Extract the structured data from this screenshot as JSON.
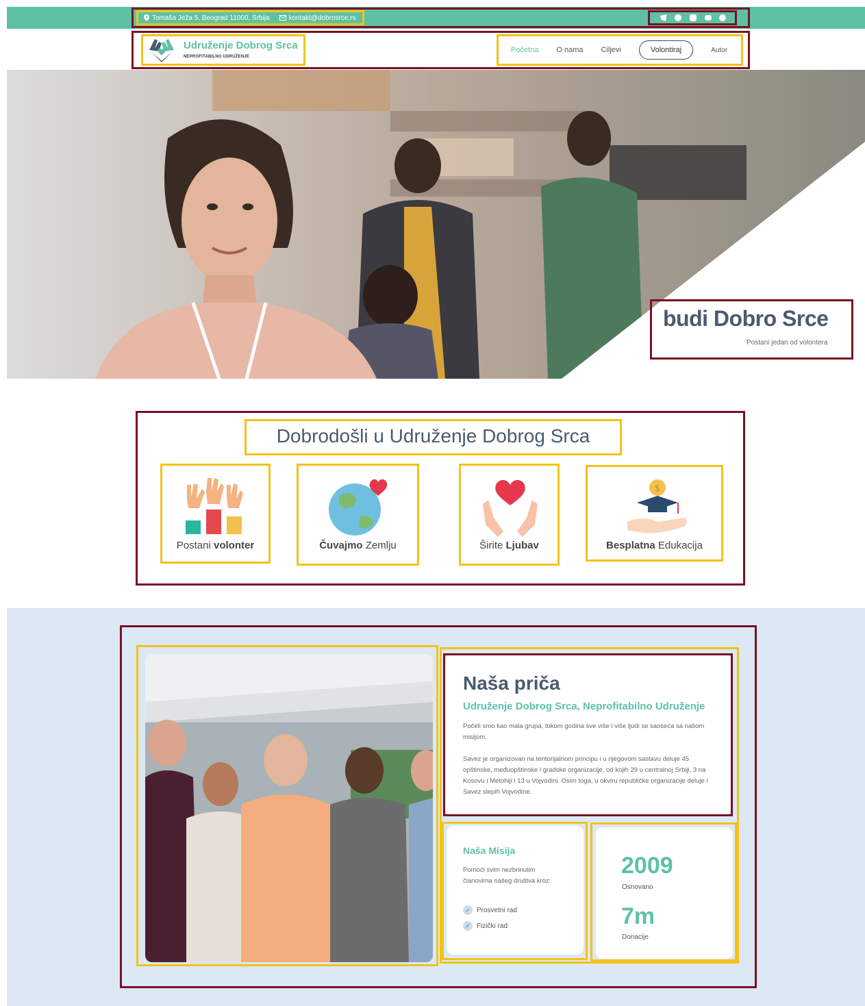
{
  "topbar": {
    "address": "Tomaša Ježa 5, Beograd 11000, Srbija",
    "email": "kontakt@dobrosrce.rs",
    "socials": [
      "twitter-icon",
      "facebook-icon",
      "instagram-icon",
      "youtube-icon",
      "whatsapp-icon"
    ]
  },
  "brand": {
    "name": "Udruženje Dobrog Srca",
    "tagline": "NEPROFITABILNO UDRUŽENJE"
  },
  "nav": {
    "items": [
      "Početna",
      "O nama",
      "Ciljevi"
    ],
    "cta": "Volontiraj",
    "author": "Autor"
  },
  "hero": {
    "title": "budi Dobro Srce",
    "subtitle": "Postani jedan od volontera"
  },
  "welcome": {
    "title": "Dobrodošli u Udruženje Dobrog Srca",
    "features": [
      {
        "pre": "Postani ",
        "bold": "volonter",
        "post": ""
      },
      {
        "pre": "",
        "bold": "Čuvajmo",
        "post": " Zemlju"
      },
      {
        "pre": "Širite ",
        "bold": "Ljubav",
        "post": ""
      },
      {
        "pre": "",
        "bold": "Besplatna",
        "post": " Edukacija"
      }
    ]
  },
  "story": {
    "title": "Naša priča",
    "subtitle": "Udruženje Dobrog Srca, Neprofitabilno Udruženje",
    "p1": "Počeli smo kao mala grupa, tokom godina sve više i više ljudi se saoseća sa našom misijom.",
    "p2": "Savez je organizovan na teritorijalnom principu i u njegovom sastavu deluje 45 opštinske, međuopštinske i gradske organizacije, od kojih 29 u centralnoj Srbiji, 3 na Kosovu i Metohiji i 13 u Vojvodini. Osim toga, u okviru republičke organizacije deluje i Savez slepih Vojvodine.",
    "mission_title": "Naša Misija",
    "mission_text": "Pomoći svim nezbrinutim članovima našeg društva kroz:",
    "mission_items": [
      "Prosvetni rad",
      "Fizički rad"
    ],
    "stat1_value": "2009",
    "stat1_label": "Osnovano",
    "stat2_value": "7m",
    "stat2_label": "Donacije"
  }
}
